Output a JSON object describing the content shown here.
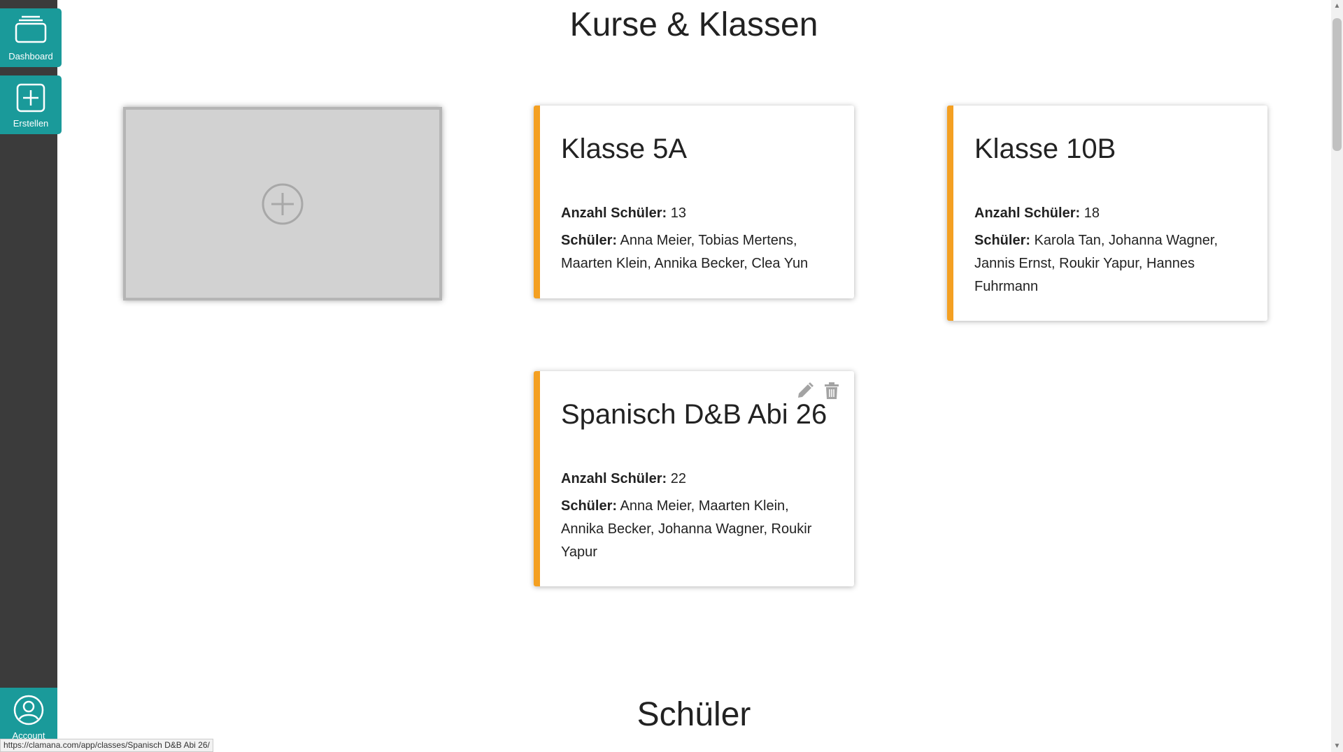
{
  "sidebar": {
    "dashboard_label": "Dashboard",
    "create_label": "Erstellen",
    "account_label": "Account"
  },
  "page": {
    "classes_heading": "Kurse & Klassen",
    "students_heading": "Schüler"
  },
  "cards": [
    {
      "title": "Klasse 5A",
      "count_label": "Anzahl Schüler:",
      "count": "13",
      "students_label": "Schüler:",
      "students": "Anna Meier, Tobias Mertens, Maarten Klein, Annika Becker, Clea Yun"
    },
    {
      "title": "Klasse 10B",
      "count_label": "Anzahl Schüler:",
      "count": "18",
      "students_label": "Schüler:",
      "students": "Karola Tan, Johanna Wagner, Jannis Ernst, Roukir Yapur, Hannes Fuhrmann"
    },
    {
      "title": "Spanisch D&B Abi 26",
      "count_label": "Anzahl Schüler:",
      "count": "22",
      "students_label": "Schüler:",
      "students": "Anna Meier, Maarten Klein, Annika Becker, Johanna Wagner, Roukir Yapur"
    }
  ],
  "status_url": "https://clamana.com/app/classes/Spanisch D&B Abi 26/",
  "colors": {
    "accent": "#1a9a9a",
    "card_border": "#f4a022",
    "sidebar": "#3b3b3b"
  },
  "icons": [
    "dashboard-icon",
    "plus-square-icon",
    "account-icon",
    "plus-circle-icon",
    "pencil-icon",
    "trash-icon"
  ]
}
